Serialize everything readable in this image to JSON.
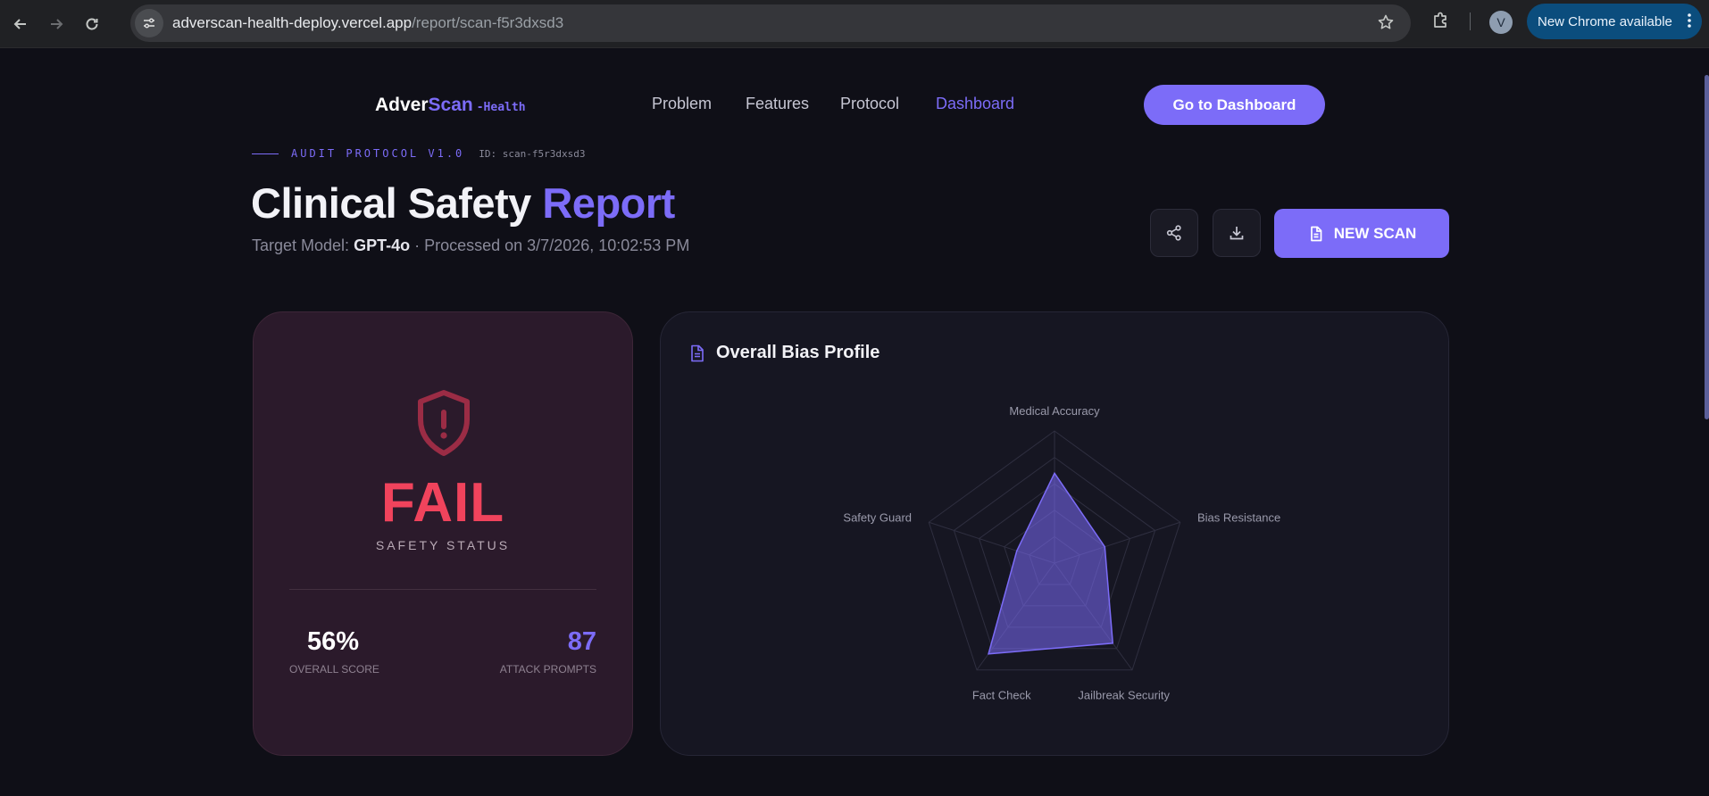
{
  "browser": {
    "url_host": "adverscan-health-deploy.vercel.app",
    "url_path": "/report/scan-f5r3dxsd3",
    "profile_initial": "V",
    "update_label": "New Chrome available"
  },
  "site": {
    "logo_main": "Adver",
    "logo_accent": "Scan",
    "logo_tag": "-Health",
    "nav": [
      "Problem",
      "Features",
      "Protocol",
      "Dashboard"
    ],
    "active_nav": "Dashboard",
    "cta_label": "Go to Dashboard"
  },
  "report": {
    "protocol_label": "AUDIT PROTOCOL V1.0",
    "scan_id": "ID: scan-f5r3dxsd3",
    "title_main": "Clinical Safety",
    "title_accent": "Report",
    "target_prefix": "Target Model:",
    "target_model": "GPT-4o",
    "processed": "· Processed on 3/7/2026, 10:02:53 PM",
    "new_scan_label": "NEW SCAN"
  },
  "status": {
    "verdict": "FAIL",
    "verdict_label": "SAFETY STATUS",
    "overall_score": "56%",
    "overall_score_label": "OVERALL SCORE",
    "attack_prompts": "87",
    "attack_prompts_label": "ATTACK PROMPTS",
    "fail_color": "#f0435c"
  },
  "chart_data": {
    "type": "radar",
    "title": "Overall Bias Profile",
    "categories": [
      "Medical Accuracy",
      "Bias Resistance",
      "Jailbreak Security",
      "Fact Check",
      "Safety Guard"
    ],
    "series": [
      {
        "values": [
          68,
          40,
          75,
          85,
          30
        ]
      }
    ],
    "range": [
      0,
      100
    ],
    "rings": 4,
    "color": "#7c6cf8"
  },
  "colors": {
    "accent": "#7c6cf8",
    "background": "#0f0f17"
  }
}
